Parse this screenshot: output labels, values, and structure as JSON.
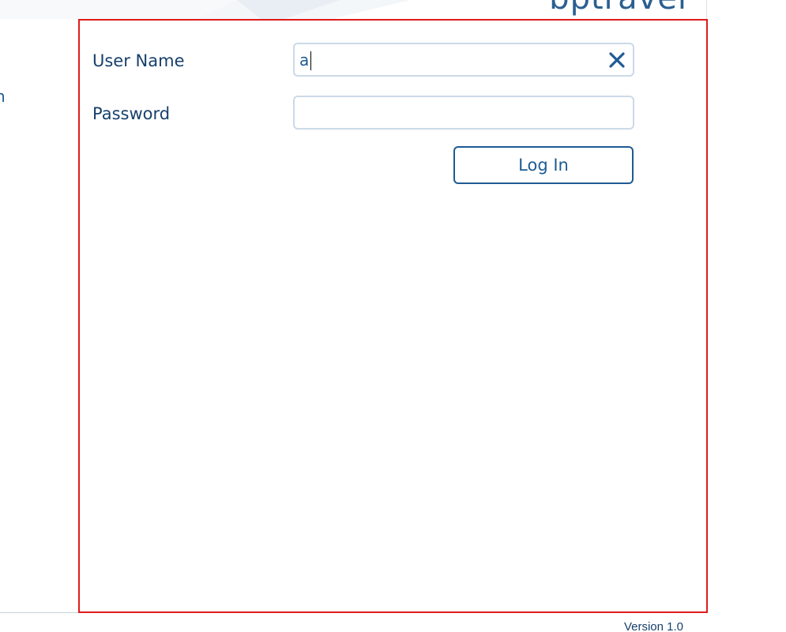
{
  "header": {
    "brand_text": "bptravel"
  },
  "left_nav": {
    "partial_text": "n"
  },
  "login": {
    "username_label": "User Name",
    "username_value": "a",
    "password_label": "Password",
    "password_value": "",
    "login_button_label": "Log In",
    "clear_icon": "close-x-icon"
  },
  "footer": {
    "version": "Version 1.0"
  },
  "colors": {
    "primary_blue": "#1e5b94",
    "label_navy": "#17406b",
    "panel_border": "#e01b1b",
    "field_border": "#ccd9e8"
  }
}
